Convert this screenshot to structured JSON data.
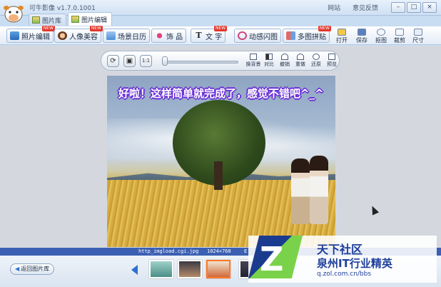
{
  "app": {
    "title": "可牛影像 v1.7.0.1001"
  },
  "top_links": [
    "网站",
    "意见反馈"
  ],
  "window_buttons": [
    "–",
    "□",
    "×"
  ],
  "tabs": [
    {
      "label": "图片库",
      "active": false
    },
    {
      "label": "图片编辑",
      "active": true
    }
  ],
  "toolbar": {
    "buttons": [
      {
        "label": "照片编辑",
        "icon": "photo-edit-icon",
        "badge": "NEW"
      },
      {
        "label": "人像美容",
        "icon": "portrait-icon",
        "badge": "NEW"
      },
      {
        "label": "场景日历",
        "icon": "scene-icon",
        "badge": ""
      },
      {
        "label": "饰 品",
        "icon": "bow-icon",
        "badge": ""
      },
      {
        "label": "文 字",
        "icon": "text-icon",
        "badge": "NEW"
      },
      {
        "label": "动感闪图",
        "icon": "flash-icon",
        "badge": ""
      },
      {
        "label": "多图拼贴",
        "icon": "collage-icon",
        "badge": "NEW"
      }
    ],
    "right_tools": [
      {
        "label": "打开",
        "icon": "open-icon"
      },
      {
        "label": "保存",
        "icon": "save-icon"
      },
      {
        "label": "抠图",
        "icon": "cutout-icon"
      },
      {
        "label": "裁剪",
        "icon": "crop-icon"
      },
      {
        "label": "尺寸",
        "icon": "size-icon"
      }
    ]
  },
  "edit_tools": {
    "left": [
      {
        "icon": "rotate-icon",
        "glyph": "⟳"
      },
      {
        "icon": "monitor-icon",
        "glyph": "▣"
      },
      {
        "icon": "actual-size-icon",
        "glyph": "1:1"
      }
    ],
    "right": [
      {
        "label": "换背景"
      },
      {
        "label": "对比"
      },
      {
        "label": "撤销"
      },
      {
        "label": "重做"
      },
      {
        "label": "还原"
      },
      {
        "label": "预览"
      }
    ]
  },
  "image": {
    "caption": "好啦！这样简单就完成了，感觉不错吧^_^"
  },
  "status": {
    "filename": "http_imgload.cgi.jpg",
    "dimensions": "1024×768",
    "extra": "E"
  },
  "bottom": {
    "back_button": "返回图片库",
    "back_icon": "back-arrow-icon"
  },
  "watermark": {
    "line1": "天下社区",
    "line2": "泉州IT行业精英",
    "url": "q.zol.com.cn/bbs"
  }
}
